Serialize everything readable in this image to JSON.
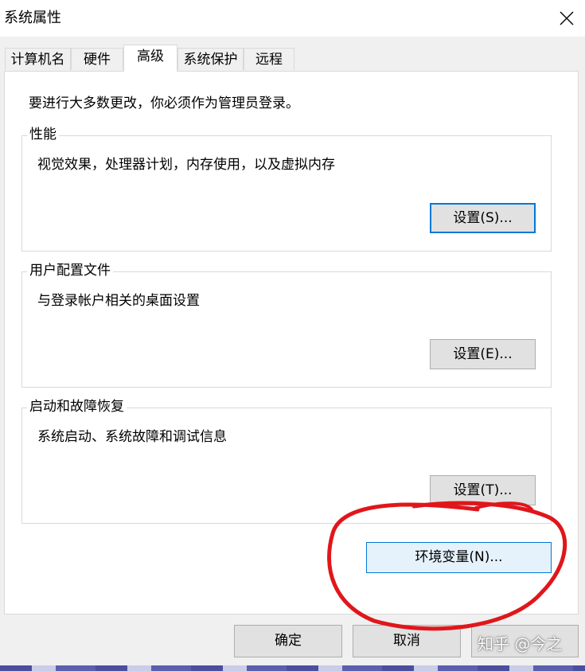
{
  "window": {
    "title": "系统属性",
    "close_icon": "close-icon"
  },
  "tabs": [
    {
      "label": "计算机名",
      "active": false
    },
    {
      "label": "硬件",
      "active": false
    },
    {
      "label": "高级",
      "active": true
    },
    {
      "label": "系统保护",
      "active": false
    },
    {
      "label": "远程",
      "active": false
    }
  ],
  "advanced": {
    "intro": "要进行大多数更改，你必须作为管理员登录。",
    "performance": {
      "label": "性能",
      "description": "视觉效果，处理器计划，内存使用，以及虚拟内存",
      "button": "设置(S)..."
    },
    "user_profiles": {
      "label": "用户配置文件",
      "description": "与登录帐户相关的桌面设置",
      "button": "设置(E)..."
    },
    "startup_recovery": {
      "label": "启动和故障恢复",
      "description": "系统启动、系统故障和调试信息",
      "button": "设置(T)..."
    },
    "env_button": "环境变量(N)..."
  },
  "footer": {
    "ok": "确定",
    "cancel": "取消"
  },
  "watermark": "知乎 @今之",
  "colors": {
    "accent": "#0078d7",
    "annotation": "#e0161b"
  }
}
